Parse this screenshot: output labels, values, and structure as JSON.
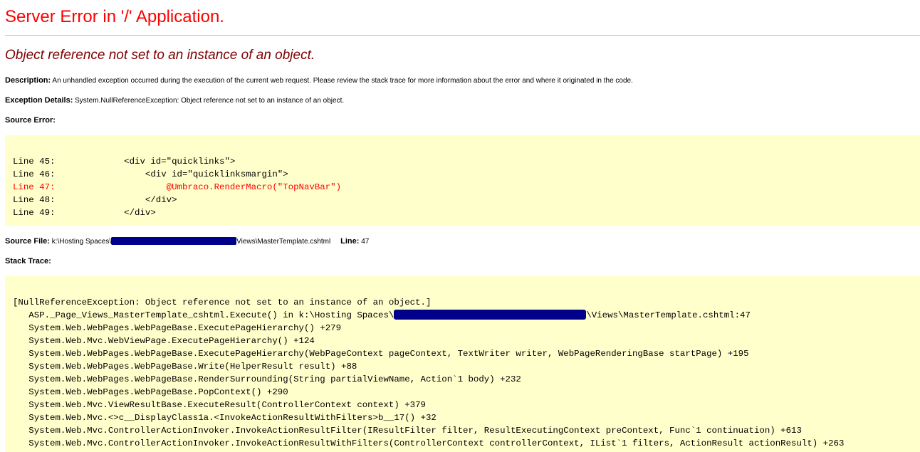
{
  "title": "Server Error in '/' Application.",
  "exception_message": "Object reference not set to an instance of an object.",
  "description": {
    "label": "Description:",
    "text": "An unhandled exception occurred during the execution of the current web request. Please review the stack trace for more information about the error and where it originated in the code."
  },
  "exception_details": {
    "label": "Exception Details:",
    "text": "System.NullReferenceException: Object reference not set to an instance of an object."
  },
  "source_error": {
    "label": "Source Error:",
    "lines": [
      {
        "number": "Line 45:",
        "code": "            <div id=\"quicklinks\">"
      },
      {
        "number": "Line 46:",
        "code": "                <div id=\"quicklinksmargin\">"
      },
      {
        "number": "Line 47:",
        "code": "                    @Umbraco.RenderMacro(\"TopNavBar\")"
      },
      {
        "number": "Line 48:",
        "code": "                </div>"
      },
      {
        "number": "Line 49:",
        "code": "            </div>"
      }
    ],
    "error_color": "#ff0000",
    "background": "#ffffcc"
  },
  "source_file": {
    "label": "Source File:",
    "path_prefix": "k:\\Hosting Spaces\\",
    "path_suffix": "Views\\MasterTemplate.cshtml",
    "line_label": "Line:",
    "line_value": "47"
  },
  "stack_trace": {
    "label": "Stack Trace:",
    "header": "[NullReferenceException: Object reference not set to an instance of an object.]",
    "frame1_prefix": "   ASP._Page_Views_MasterTemplate_cshtml.Execute() in k:\\Hosting Spaces\\",
    "frame1_suffix": "\\Views\\MasterTemplate.cshtml:47",
    "frames": [
      "   System.Web.WebPages.WebPageBase.ExecutePageHierarchy() +279",
      "   System.Web.Mvc.WebViewPage.ExecutePageHierarchy() +124",
      "   System.Web.WebPages.WebPageBase.ExecutePageHierarchy(WebPageContext pageContext, TextWriter writer, WebPageRenderingBase startPage) +195",
      "   System.Web.WebPages.WebPageBase.Write(HelperResult result) +88",
      "   System.Web.WebPages.WebPageBase.RenderSurrounding(String partialViewName, Action`1 body) +232",
      "   System.Web.WebPages.WebPageBase.PopContext() +290",
      "   System.Web.Mvc.ViewResultBase.ExecuteResult(ControllerContext context) +379",
      "   System.Web.Mvc.<>c__DisplayClass1a.<InvokeActionResultWithFilters>b__17() +32",
      "   System.Web.Mvc.ControllerActionInvoker.InvokeActionResultFilter(IResultFilter filter, ResultExecutingContext preContext, Func`1 continuation) +613",
      "   System.Web.Mvc.ControllerActionInvoker.InvokeActionResultWithFilters(ControllerContext controllerContext, IList`1 filters, ActionResult actionResult) +263"
    ]
  },
  "colors": {
    "title": "#ff0000",
    "exception_message": "#800000",
    "code_background": "#ffffcc",
    "redaction": "#00008b"
  }
}
